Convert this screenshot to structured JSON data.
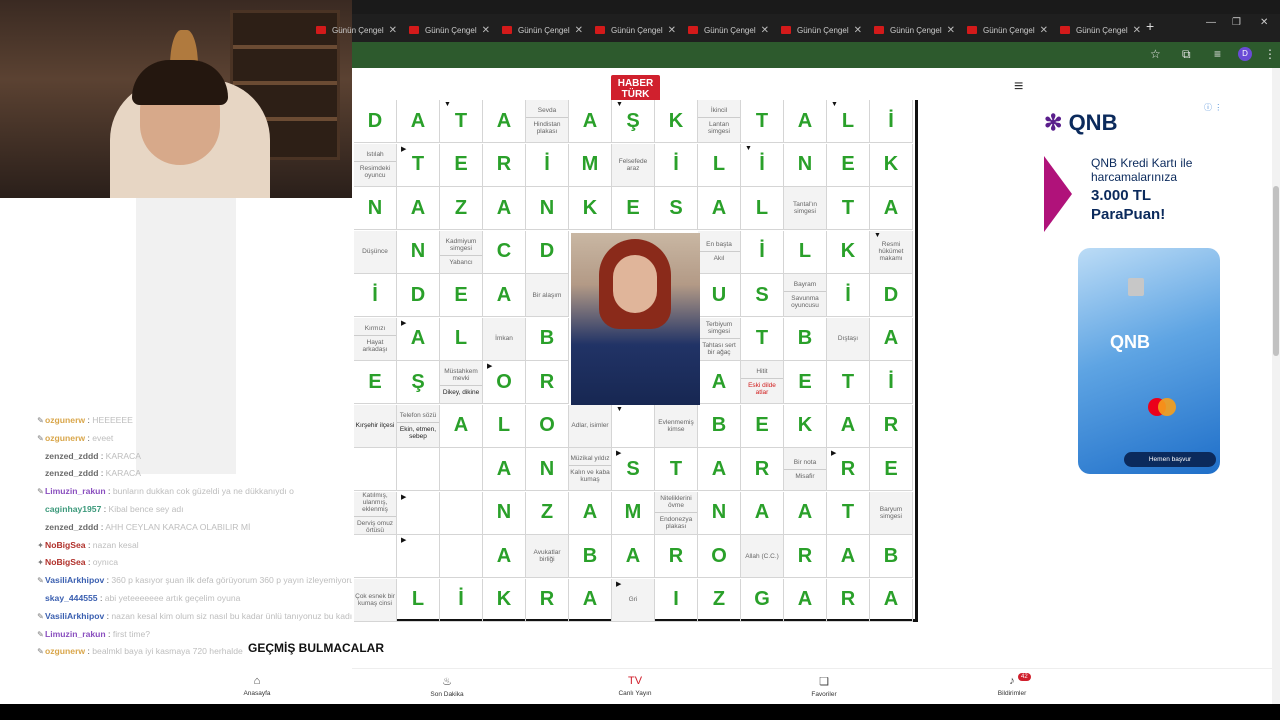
{
  "browser": {
    "tab_title": "Günün Çengel",
    "tab_count": 9,
    "new_tab": "+",
    "minimize": "—",
    "maximize": "❐",
    "close": "✕",
    "bookmark_icon": "☆",
    "extensions_icon": "⧉",
    "media_icon": "≡",
    "profile_letter": "D",
    "more_icon": "⋮"
  },
  "site": {
    "logo_line1": "HABER",
    "logo_line2": "TÜRK",
    "menu_icon": "≡"
  },
  "chat": [
    {
      "user": "ozgunerw",
      "user_color": "#d9a64a",
      "msg": "HEEEEEE",
      "icon": "pencil"
    },
    {
      "user": "ozgunerw",
      "user_color": "#d9a64a",
      "msg": "eveet",
      "icon": "pencil"
    },
    {
      "user": "zenzed_zddd",
      "user_color": "#6b6b6b",
      "msg": "KARACA",
      "icon": ""
    },
    {
      "user": "zenzed_zddd",
      "user_color": "#6b6b6b",
      "msg": "KARACA",
      "icon": ""
    },
    {
      "user": "Limuzin_rakun",
      "user_color": "#8a4fbf",
      "msg": "bunların dukkan cok güzeldi ya ne dükkanıydı o",
      "icon": "pencil"
    },
    {
      "user": "caginhay1957",
      "user_color": "#3d9a7c",
      "msg": "Kibal bence sey adı",
      "icon": ""
    },
    {
      "user": "zenzed_zddd",
      "user_color": "#6b6b6b",
      "msg": "AHH CEYLAN KARACA OLABILIR Mİ",
      "icon": ""
    },
    {
      "user": "NoBigSea",
      "user_color": "#b0302a",
      "msg": "nazan kesal",
      "icon": "badge"
    },
    {
      "user": "NoBigSea",
      "user_color": "#b0302a",
      "msg": "oynıca",
      "icon": "badge"
    },
    {
      "user": "VasiliArkhipov",
      "user_color": "#3a5fb0",
      "msg": "360 p kasıyor şuan ilk defa görüyorum 360 p yayın izleyemiyorum 720 p bile zor okuyorum zaten daha fazla katılamam",
      "icon": "pencil"
    },
    {
      "user": "skay_444555",
      "user_color": "#3a5fb0",
      "msg": "abi yeteeeeeee artık geçelim oyuna",
      "icon": ""
    },
    {
      "user": "VasiliArkhipov",
      "user_color": "#3a5fb0",
      "msg": "nazan kesal kim olum siz nasıl bu kadar ünlü tanıyonuz bu kadın kardeşi tanımaz şuan",
      "icon": "pencil"
    },
    {
      "user": "Limuzin_rakun",
      "user_color": "#8a4fbf",
      "msg": "first time?",
      "icon": "pencil"
    },
    {
      "user": "ozgunerw",
      "user_color": "#d9a64a",
      "msg": "bealmkl baya iyi kasmaya 720 herhalde",
      "icon": "pencil"
    }
  ],
  "puzzle": {
    "past_puzzles": "GEÇMİŞ BULMACALAR",
    "rows": [
      [
        "",
        "D",
        "A",
        "T",
        "A",
        "A",
        "Ş",
        "K",
        "T",
        "A",
        "L",
        "İ"
      ],
      [
        "",
        "T",
        "E",
        "R",
        "İ",
        "M",
        "İ",
        "L",
        "İ",
        "N",
        "E",
        "K"
      ],
      [
        "N",
        "A",
        "Z",
        "A",
        "N",
        "K",
        "E",
        "S",
        "A",
        "L",
        "T",
        "A"
      ],
      [
        "",
        "N",
        "C",
        "D",
        "",
        "",
        "",
        "İ",
        "L",
        "K",
        "",
        ""
      ],
      [
        "İ",
        "D",
        "E",
        "A",
        "",
        "",
        "",
        "U",
        "S",
        "İ",
        "D",
        ""
      ],
      [
        "",
        "A",
        "L",
        "B",
        "",
        "",
        "",
        "T",
        "B",
        "",
        "A",
        ""
      ],
      [
        "E",
        "Ş",
        "O",
        "R",
        "",
        "",
        "",
        "A",
        "E",
        "T",
        "İ",
        ""
      ],
      [
        "",
        "A",
        "L",
        "O",
        "",
        "",
        "",
        "B",
        "E",
        "K",
        "A",
        "R"
      ],
      [
        "",
        "",
        "A",
        "N",
        "S",
        "T",
        "A",
        "R",
        "R",
        "E",
        "",
        ""
      ],
      [
        "",
        "",
        "N",
        "Z",
        "A",
        "M",
        "N",
        "A",
        "A",
        "T",
        "",
        ""
      ],
      [
        "",
        "",
        "A",
        "B",
        "A",
        "R",
        "O",
        "R",
        "A",
        "B",
        "",
        ""
      ],
      [
        "",
        "L",
        "İ",
        "K",
        "R",
        "A",
        "I",
        "Z",
        "G",
        "A",
        "R",
        "A"
      ]
    ],
    "clues": {
      "sevda": "Sevda",
      "hindistan": "Hindistan plakası",
      "ikincil": "İkincil",
      "lantan": "Lantan simgesi",
      "istilah": "Istılah",
      "resimdeki": "Resimdeki oyuncu",
      "felsefe": "Felsefede araz",
      "tantal": "Tantal'ın simgesi",
      "dusunce": "Düşünce",
      "kadmiyum": "Kadmiyum simgesi",
      "yabanci": "Yabancı",
      "enbasta": "En başta",
      "akil": "Akıl",
      "resmi": "Resmi hükümet makamı",
      "bayram": "Bayram",
      "savunma": "Savunma oyuncusu",
      "biralasim": "Bir alaşım",
      "kirmizi": "Kırmızı",
      "hayat": "Hayat arkadaşı",
      "imkan": "İmkan",
      "terbiyum": "Terbiyum simgesi",
      "tahtasi": "Tahtası sert bir ağaç",
      "distas": "Dıştaşı",
      "mustahkem": "Müstahkem mevki",
      "dikey": "Dikey, dikine",
      "hitit": "Hitit",
      "eskidilde": "Eski dilde atlar",
      "kirsehir": "Kırşehir ilçesi",
      "telefon": "Telefon sözü",
      "ekinetmen": "Ekin, etmen, sebep",
      "adlar": "Adlar, isimler",
      "evlenmemis": "Evlenmemiş kimse",
      "muzikal": "Müzikal yıldız",
      "kalin": "Kalın ve kaba kumaş",
      "birnota": "Bir nota",
      "misafir": "Misafir",
      "katilmis": "Katılmış, ulanmış, eklenmiş",
      "dervis": "Derviş omuz örtüsü",
      "nitelik": "Niteliklerini övme",
      "endonezya": "Endonezya plakası",
      "baryum": "Baryum simgesi",
      "avukatlar": "Avukatlar birliği",
      "allah": "Allah (C.C.)",
      "cokesnek": "Çok esnek bir kumaş cinsi",
      "gri": "Gri"
    }
  },
  "ad": {
    "brand": "QNB",
    "line1": "QNB Kredi Kartı ile harcamalarınıza",
    "line2": "3.000 TL ParaPuan!",
    "card_brand": "QNB",
    "cta": "Hemen başvur",
    "info": "ⓘ ⋮"
  },
  "bottom_nav": [
    {
      "label": "Anasayfa",
      "icon": "home-icon",
      "glyph": "⌂"
    },
    {
      "label": "Son Dakika",
      "icon": "flame-icon",
      "glyph": "♨"
    },
    {
      "label": "Canlı Yayın",
      "icon": "tv-icon",
      "glyph": "TV"
    },
    {
      "label": "Favoriler",
      "icon": "bookmark-icon",
      "glyph": "❏"
    },
    {
      "label": "Bildirimler",
      "icon": "bell-icon",
      "glyph": "♪",
      "badge": "42"
    }
  ],
  "colors": {
    "letter_green": "#2aa02a",
    "brand_red": "#d0202d",
    "address_bar": "#2d5a2d"
  }
}
